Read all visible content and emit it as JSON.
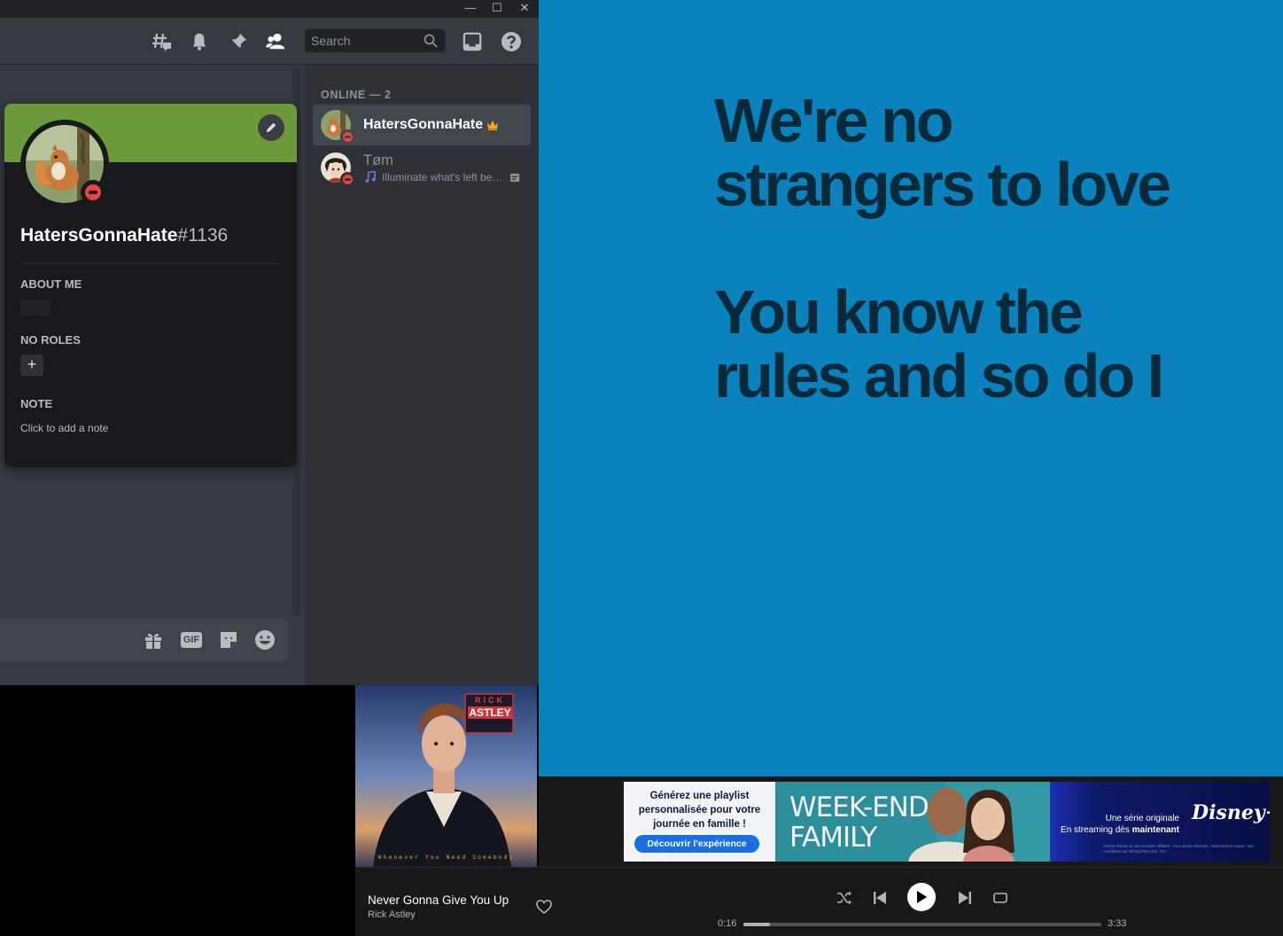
{
  "discord": {
    "window_controls": {
      "minimize": "—",
      "maximize": "☐",
      "close": "✕"
    },
    "header": {
      "search_placeholder": "Search"
    },
    "profile": {
      "username": "HatersGonnaHate",
      "discriminator": "#1136",
      "about_title": "ABOUT ME",
      "roles_title": "NO ROLES",
      "add_role_label": "+",
      "note_title": "NOTE",
      "note_placeholder": "Click to add a note",
      "banner_color": "#6b9a3a"
    },
    "member_list": {
      "header": "ONLINE — 2",
      "members": [
        {
          "name": "HatersGonnaHate",
          "status": "dnd",
          "owner": true,
          "activity": ""
        },
        {
          "name": "Tøm",
          "status": "dnd",
          "owner": false,
          "activity": "Illuminate what's left behind"
        }
      ]
    },
    "composer": {
      "gif_label": "GIF"
    }
  },
  "lyrics": {
    "lines": [
      "We're no",
      "strangers to love",
      "",
      "You know the",
      "rules and so do I"
    ],
    "background": "#0a82bd",
    "text_color": "#062a3a"
  },
  "ad": {
    "left_text": "Générez une playlist personnalisée pour votre journée en famille !",
    "cta": "Découvrir l'expérience",
    "title_line1": "WEEK-END",
    "title_line2": "FAMILY",
    "right_line1": "Une série originale",
    "right_line2_prefix": "En streaming dès ",
    "right_line2_bold": "maintenant",
    "logo": "Disney+",
    "legal": "©2022 Disney et ses sociétés affiliées. Tous droits réservés. Abonnement requis. Voir conditions sur DisneyPlus.com. 18+"
  },
  "album": {
    "banner_top": "RICK",
    "banner_main": "ASTLEY",
    "bottom_text": "Whenever You Need Somebody"
  },
  "player": {
    "title": "Never Gonna Give You Up",
    "artist": "Rick Astley",
    "elapsed": "0:16",
    "duration": "3:33",
    "progress_fraction": 0.075
  }
}
